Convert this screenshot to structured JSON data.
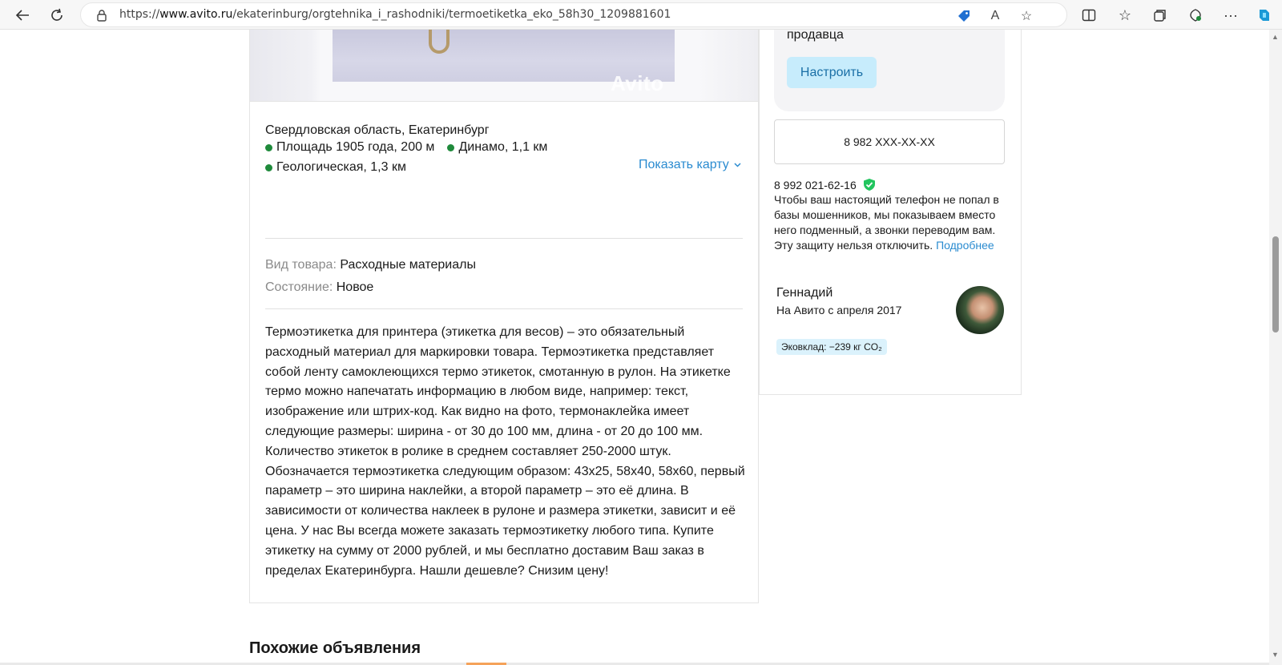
{
  "browser": {
    "url_scheme": "https://",
    "url_host": "www.avito.ru",
    "url_path": "/ekaterinburg/orgtehnika_i_rashodniki/termoetiketka_eko_58h30_1209881601",
    "icons": [
      "back-icon",
      "refresh-icon",
      "lock-icon",
      "shopping-tag-icon",
      "read-aloud-icon",
      "favorite-star-icon",
      "split-screen-icon",
      "favorites-icon",
      "collections-icon",
      "browser-essentials-icon",
      "more-icon",
      "copilot-icon"
    ]
  },
  "listing": {
    "watermark": "Avito",
    "address": "Свердловская область, Екатеринбург",
    "metro": [
      {
        "name": "Площадь 1905 года, 200 м"
      },
      {
        "name": "Динамо, 1,1 км"
      },
      {
        "name": "Геологическая, 1,3 км"
      }
    ],
    "show_map": "Показать карту",
    "params": [
      {
        "key": "Вид товара:",
        "value": "Расходные материалы"
      },
      {
        "key": "Состояние:",
        "value": "Новое"
      }
    ],
    "description": "Термоэтикетка для принтера (этикетка для весов) – это обязательный расходный материал для маркировки товара. Термоэтикетка представляет собой ленту самоклеющихся термо этикеток, смотанную в рулон. На этикетке термо можно напечатать информацию в любом виде, например: текст, изображение или штрих-код. Как видно на фото, термонаклейка имеет следующие размеры: ширина - от 30 до 100 мм, длина - от 20 до 100 мм. Количество этикеток в ролике в среднем составляет 250-2000 штук. Обозначается термоэтикетка следующим образом: 43х25, 58х40, 58х60, первый параметр – это ширина наклейки, а второй параметр – это её длина. В зависимости от количества наклеек в рулоне и размера этикетки, зависит и её цена. У нас Вы всегда можете заказать термоэтикетку любого типа. Купите этикетку на сумму от 2000 рублей, и мы бесплатно доставим Ваш заказ в пределах Екатеринбурга. Нашли дешевле? Снизим цену!"
  },
  "sidebar": {
    "seller_sub": "продавца",
    "setup_label": "Настроить",
    "phone_masked": "8 982 XXX-XX-XX",
    "safe_phone": "8 992 021-62-16",
    "safe_text": "Чтобы ваш настоящий телефон не попал в базы мошенников, мы показываем вместо него подменный, а звонки переводим вам. Эту защиту нельзя отключить.",
    "more_link": "Подробнее",
    "seller_name": "Геннадий",
    "seller_since": "На Авито с апреля 2017",
    "eco_badge": "Эковклад: −239 кг CO₂"
  },
  "section": {
    "similar_title": "Похожие объявления"
  },
  "colors": {
    "link": "#2a8bd0",
    "metro_dot": "#1f8a3b",
    "setup_bg": "#c7ecfc",
    "eco_bg": "#dbf2fc",
    "shield": "#22c55e"
  }
}
